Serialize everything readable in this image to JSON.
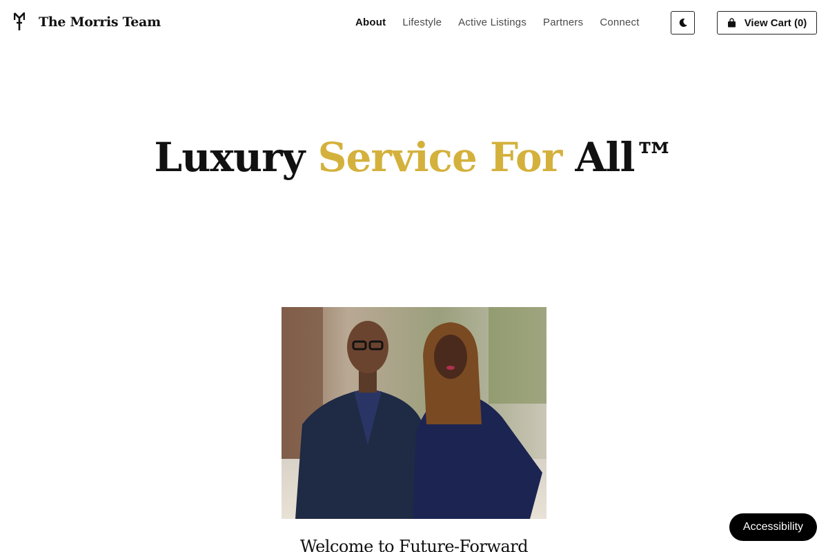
{
  "header": {
    "brand": "The Morris Team",
    "logo_icon": "morris-monogram-icon",
    "nav": [
      {
        "label": "About",
        "active": true
      },
      {
        "label": "Lifestyle",
        "active": false
      },
      {
        "label": "Active Listings",
        "active": false
      },
      {
        "label": "Partners",
        "active": false
      },
      {
        "label": "Connect",
        "active": false
      }
    ],
    "theme_toggle_icon": "moon-icon",
    "cart": {
      "label": "View Cart (0)",
      "icon": "shopping-bag-icon"
    }
  },
  "hero": {
    "title_part1": "Luxury ",
    "title_accent": "Service For",
    "title_part2": " All™"
  },
  "photo": {
    "alt": "The Morris Team portrait"
  },
  "welcome": {
    "heading": "Welcome to Future-Forward"
  },
  "accessibility": {
    "label": "Accessibility"
  },
  "colors": {
    "accent": "#d4b13c",
    "text": "#111111",
    "nav_text": "#4a4a4a",
    "background": "#ffffff"
  }
}
